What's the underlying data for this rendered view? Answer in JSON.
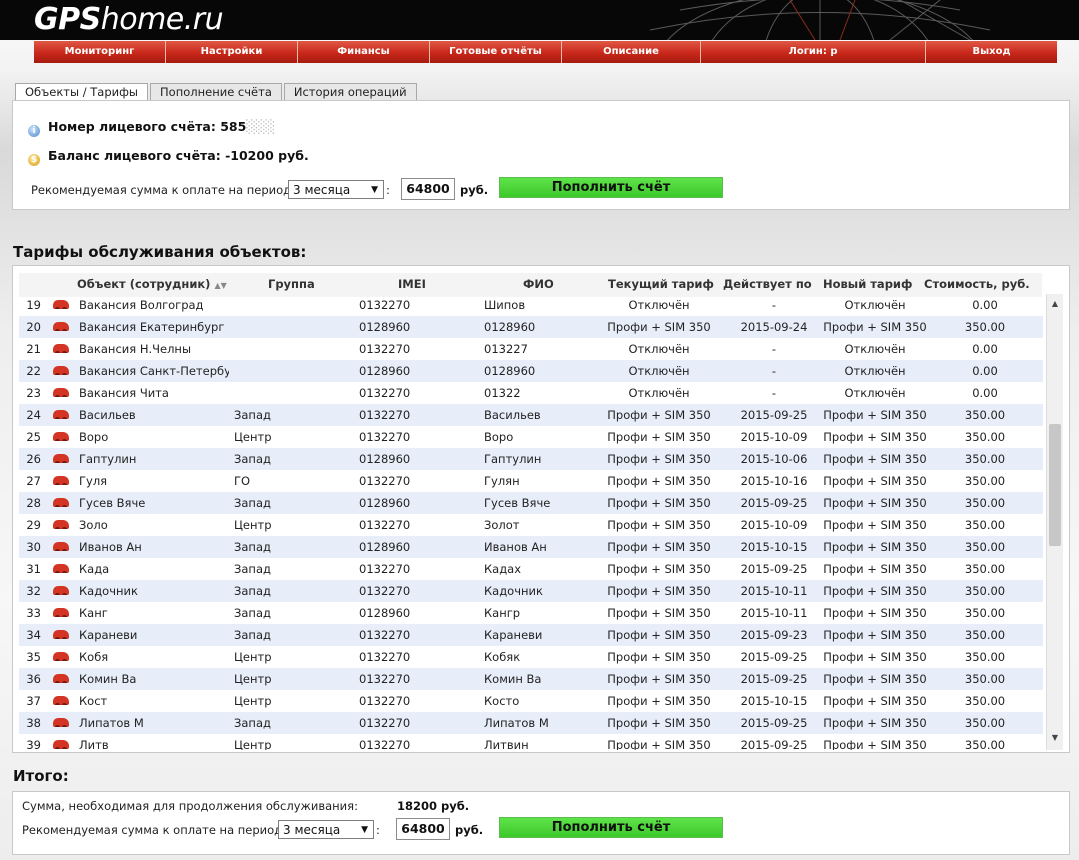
{
  "header": {
    "logo_bold": "GPS",
    "logo_rest": "home.ru"
  },
  "nav": {
    "items": [
      "Мониторинг",
      "Настройки",
      "Финансы",
      "Готовые отчёты",
      "Описание",
      "Логин: p",
      "Выход"
    ]
  },
  "tabs": [
    "Объекты / Тарифы",
    "Пополнение счёта",
    "История операций"
  ],
  "account": {
    "number_label": "Номер лицевого счёта:",
    "number_value": "585",
    "balance_label": "Баланс лицевого счёта:",
    "balance_value": "-10200 руб.",
    "recommend_label": "Рекомендуемая сумма к оплате на период",
    "period": "3 месяца",
    "colon": ":",
    "amount": "64800",
    "unit": "руб.",
    "button": "Пополнить счёт"
  },
  "table_section": {
    "title": "Тарифы обслуживания объектов:",
    "columns": [
      "Объект (сотрудник)",
      "Группа",
      "IMEI",
      "ФИО",
      "Текущий тариф",
      "Действует по",
      "Новый тариф",
      "Стоимость, руб."
    ],
    "sort_indicator": "▲▼",
    "rows": [
      {
        "n": "19",
        "name": "Вакансия Волгоград",
        "group": "",
        "imei": "0132270",
        "fio": "Шипов",
        "cur": "Отключён",
        "till": "-",
        "new": "Отключён",
        "cost": "0.00"
      },
      {
        "n": "20",
        "name": "Вакансия Екатеринбург",
        "group": "",
        "imei": "0128960",
        "fio": "0128960",
        "cur": "Профи + SIM 350",
        "till": "2015-09-24",
        "new": "Профи + SIM 350",
        "cost": "350.00"
      },
      {
        "n": "21",
        "name": "Вакансия Н.Челны",
        "group": "",
        "imei": "0132270",
        "fio": "013227",
        "cur": "Отключён",
        "till": "-",
        "new": "Отключён",
        "cost": "0.00"
      },
      {
        "n": "22",
        "name": "Вакансия Санкт-Петербург",
        "group": "",
        "imei": "0128960",
        "fio": "0128960",
        "cur": "Отключён",
        "till": "-",
        "new": "Отключён",
        "cost": "0.00"
      },
      {
        "n": "23",
        "name": "Вакансия Чита",
        "group": "",
        "imei": "0132270",
        "fio": "01322",
        "cur": "Отключён",
        "till": "-",
        "new": "Отключён",
        "cost": "0.00"
      },
      {
        "n": "24",
        "name": "Васильев",
        "group": "Запад",
        "imei": "0132270",
        "fio": "Васильев",
        "cur": "Профи + SIM 350",
        "till": "2015-09-25",
        "new": "Профи + SIM 350",
        "cost": "350.00"
      },
      {
        "n": "25",
        "name": "Воро",
        "group": "Центр",
        "imei": "0132270",
        "fio": "Воро",
        "cur": "Профи + SIM 350",
        "till": "2015-10-09",
        "new": "Профи + SIM 350",
        "cost": "350.00"
      },
      {
        "n": "26",
        "name": "Гаптулин",
        "group": "Запад",
        "imei": "0128960",
        "fio": "Гаптулин",
        "cur": "Профи + SIM 350",
        "till": "2015-10-06",
        "new": "Профи + SIM 350",
        "cost": "350.00"
      },
      {
        "n": "27",
        "name": "Гуля",
        "group": "ГО",
        "imei": "0132270",
        "fio": "Гулян",
        "cur": "Профи + SIM 350",
        "till": "2015-10-16",
        "new": "Профи + SIM 350",
        "cost": "350.00"
      },
      {
        "n": "28",
        "name": "Гусев Вяче",
        "group": "Запад",
        "imei": "0128960",
        "fio": "Гусев Вяче",
        "cur": "Профи + SIM 350",
        "till": "2015-09-25",
        "new": "Профи + SIM 350",
        "cost": "350.00"
      },
      {
        "n": "29",
        "name": "Золо",
        "group": "Центр",
        "imei": "0132270",
        "fio": "Золот",
        "cur": "Профи + SIM 350",
        "till": "2015-10-09",
        "new": "Профи + SIM 350",
        "cost": "350.00"
      },
      {
        "n": "30",
        "name": "Иванов Ан",
        "group": "Запад",
        "imei": "0128960",
        "fio": "Иванов Ан",
        "cur": "Профи + SIM 350",
        "till": "2015-10-15",
        "new": "Профи + SIM 350",
        "cost": "350.00"
      },
      {
        "n": "31",
        "name": "Када",
        "group": "Запад",
        "imei": "0132270",
        "fio": "Кадах",
        "cur": "Профи + SIM 350",
        "till": "2015-09-25",
        "new": "Профи + SIM 350",
        "cost": "350.00"
      },
      {
        "n": "32",
        "name": "Кадочник",
        "group": "Запад",
        "imei": "0132270",
        "fio": "Кадочник",
        "cur": "Профи + SIM 350",
        "till": "2015-10-11",
        "new": "Профи + SIM 350",
        "cost": "350.00"
      },
      {
        "n": "33",
        "name": "Канг",
        "group": "Запад",
        "imei": "0128960",
        "fio": "Кангр",
        "cur": "Профи + SIM 350",
        "till": "2015-10-11",
        "new": "Профи + SIM 350",
        "cost": "350.00"
      },
      {
        "n": "34",
        "name": "Караневи",
        "group": "Запад",
        "imei": "0132270",
        "fio": "Караневи",
        "cur": "Профи + SIM 350",
        "till": "2015-09-23",
        "new": "Профи + SIM 350",
        "cost": "350.00"
      },
      {
        "n": "35",
        "name": "Кобя",
        "group": "Центр",
        "imei": "0132270",
        "fio": "Кобяк",
        "cur": "Профи + SIM 350",
        "till": "2015-09-25",
        "new": "Профи + SIM 350",
        "cost": "350.00"
      },
      {
        "n": "36",
        "name": "Комин Ва",
        "group": "Центр",
        "imei": "0132270",
        "fio": "Комин Ва",
        "cur": "Профи + SIM 350",
        "till": "2015-09-25",
        "new": "Профи + SIM 350",
        "cost": "350.00"
      },
      {
        "n": "37",
        "name": "Кост",
        "group": "Центр",
        "imei": "0132270",
        "fio": "Косто",
        "cur": "Профи + SIM 350",
        "till": "2015-10-15",
        "new": "Профи + SIM 350",
        "cost": "350.00"
      },
      {
        "n": "38",
        "name": "Липатов М",
        "group": "Запад",
        "imei": "0132270",
        "fio": "Липатов М",
        "cur": "Профи + SIM 350",
        "till": "2015-09-25",
        "new": "Профи + SIM 350",
        "cost": "350.00"
      },
      {
        "n": "39",
        "name": "Литв",
        "group": "Центр",
        "imei": "0132270",
        "fio": "Литвин",
        "cur": "Профи + SIM 350",
        "till": "2015-09-25",
        "new": "Профи + SIM 350",
        "cost": "350.00"
      }
    ]
  },
  "total": {
    "title": "Итого:",
    "need_label": "Сумма, необходимая для продолжения обслуживания:",
    "need_value": "18200 руб.",
    "recommend_label": "Рекомендуемая сумма к оплате на период",
    "period": "3 месяца",
    "colon": ":",
    "amount": "64800",
    "unit": "руб.",
    "button": "Пополнить счёт"
  },
  "colors": {
    "nav_red": "#c8281a",
    "green_button": "#4fd63b",
    "row_alt": "#e8eef9"
  },
  "icons": {
    "account": "info-icon",
    "balance": "coin-icon",
    "row": "car-icon"
  }
}
